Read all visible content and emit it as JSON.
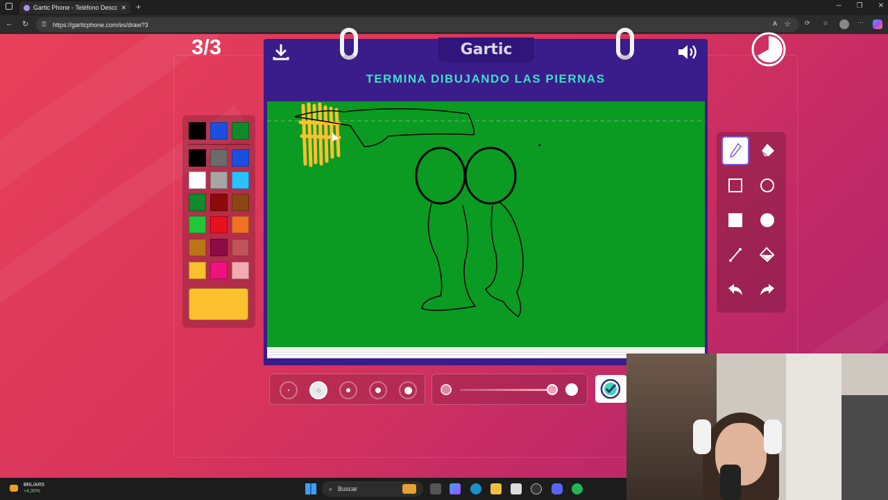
{
  "browser": {
    "tab_title": "Gartic Phone - Teléfono Descomp",
    "url": "https://garticphone.com/es/draw?3"
  },
  "game": {
    "round": "3/3",
    "logo": "Gartic",
    "prompt": "TERMINA DIBUJANDO LAS PIERNAS",
    "selected_color": "#fbc02d",
    "palette": [
      [
        "#000000",
        "#1a4fe0",
        "#118a2c"
      ],
      [
        "#000000",
        "#6b6b6b",
        "#1a4fe0"
      ],
      [
        "#ffffff",
        "#a6a6a6",
        "#2dc0ff"
      ],
      [
        "#118a2c",
        "#8f0a0a",
        "#8c4515"
      ],
      [
        "#22c63a",
        "#e8101e",
        "#f07024"
      ],
      [
        "#b87617",
        "#8c0c43",
        "#c0525a"
      ],
      [
        "#fbc02d",
        "#f0127e",
        "#f5a9b0"
      ]
    ],
    "canvas_color": "#0b9a22",
    "tools": [
      "pen-icon",
      "eraser-icon",
      "rectangle-outline-icon",
      "circle-outline-icon",
      "rectangle-fill-icon",
      "circle-fill-icon",
      "line-icon",
      "fill-bucket-icon",
      "undo-icon",
      "redo-icon"
    ],
    "brush_sizes_selected": 1,
    "opacity_slider": 0.9
  },
  "taskbar": {
    "ticker_symbol": "BRL/ARS",
    "ticker_change": "+4,30%",
    "search_placeholder": "Buscar"
  }
}
